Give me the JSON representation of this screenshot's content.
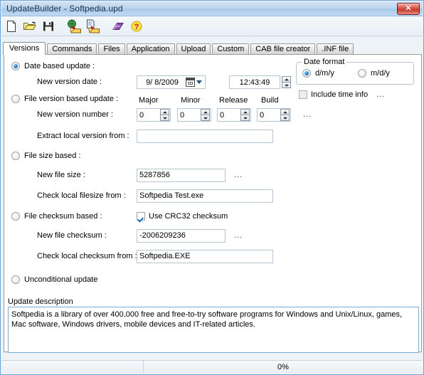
{
  "window": {
    "title": "UpdateBuilder - Softpedia.upd",
    "close_label": "✕"
  },
  "toolbar": {
    "buttons": [
      {
        "name": "new-file-icon",
        "tooltip": "New"
      },
      {
        "name": "open-folder-icon",
        "tooltip": "Open"
      },
      {
        "name": "save-disk-icon",
        "tooltip": "Save"
      },
      {
        "name": "globe-import-icon",
        "tooltip": "Import from web"
      },
      {
        "name": "document-import-icon",
        "tooltip": "Import from file"
      },
      {
        "name": "book-icon",
        "tooltip": "Help book"
      },
      {
        "name": "question-help-icon",
        "tooltip": "Help"
      }
    ]
  },
  "tabs": [
    {
      "label": "Versions",
      "active": true
    },
    {
      "label": "Commands",
      "active": false
    },
    {
      "label": "Files",
      "active": false
    },
    {
      "label": "Application",
      "active": false
    },
    {
      "label": "Upload",
      "active": false
    },
    {
      "label": "Custom",
      "active": false
    },
    {
      "label": "CAB file creator",
      "active": false
    },
    {
      "label": ".INF file",
      "active": false
    }
  ],
  "versions": {
    "date_based": {
      "radio_label": "Date based update :",
      "selected": true,
      "version_date_label": "New version date :",
      "date_value": "9/  8/2009",
      "time_value": "12:43:49"
    },
    "date_format": {
      "group_title": "Date format",
      "option_dmy": "d/m/y",
      "option_mdy": "m/d/y",
      "selected": "d/m/y",
      "include_time_label": "Include time info",
      "include_time_checked": false,
      "include_time_dots": "..."
    },
    "file_version_based": {
      "radio_label": "File version based update :",
      "selected": false,
      "version_number_label": "New version number :",
      "col_major": "Major",
      "col_minor": "Minor",
      "col_release": "Release",
      "col_build": "Build",
      "major": "0",
      "minor": "0",
      "release": "0",
      "build": "0",
      "dots": "...",
      "extract_label": "Extract local version from :",
      "extract_value": ""
    },
    "file_size_based": {
      "radio_label": "File size based :",
      "selected": false,
      "new_size_label": "New file size :",
      "new_size_value": "5287856",
      "size_dots": "...",
      "check_local_label": "Check local filesize from :",
      "check_local_value": "Softpedia Test.exe"
    },
    "file_checksum_based": {
      "radio_label": "File checksum based :",
      "selected": false,
      "crc_label": "Use CRC32 checksum",
      "crc_checked": true,
      "new_checksum_label": "New file checksum :",
      "new_checksum_value": "-2006209236",
      "checksum_dots": "...",
      "check_local_label": "Check local checksum from :",
      "check_local_value": "Softpedia.EXE"
    },
    "unconditional": {
      "radio_label": "Unconditional update",
      "selected": false
    }
  },
  "description": {
    "label": "Update description",
    "text": "Softpedia is a library of over 400,000 free and free-to-try software programs for Windows and Unix/Linux, games, Mac software, Windows drivers, mobile devices and IT-related articles."
  },
  "statusbar": {
    "left_text": "",
    "progress_text": "0%"
  }
}
